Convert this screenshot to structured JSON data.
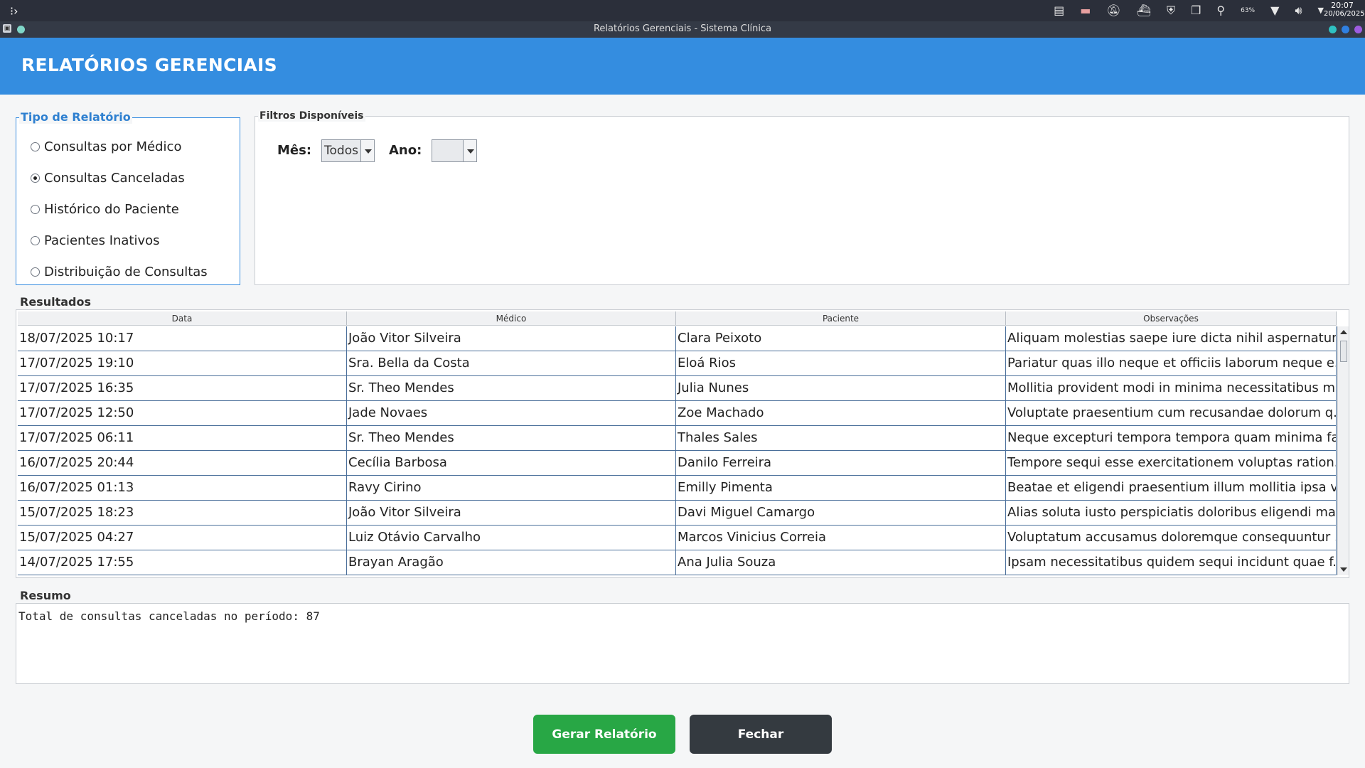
{
  "system": {
    "time": "20:07",
    "date": "20/06/2025",
    "battery": "63%"
  },
  "window": {
    "title": "Relatórios Gerenciais - Sistema Clínica"
  },
  "header": {
    "title": "RELATÓRIOS GERENCIAIS"
  },
  "report_types": {
    "legend": "Tipo de Relatório",
    "items": [
      {
        "label": "Consultas por Médico",
        "selected": false
      },
      {
        "label": "Consultas Canceladas",
        "selected": true
      },
      {
        "label": "Histórico do Paciente",
        "selected": false
      },
      {
        "label": "Pacientes Inativos",
        "selected": false
      },
      {
        "label": "Distribuição de Consultas",
        "selected": false
      }
    ]
  },
  "filters": {
    "legend": "Filtros Disponíveis",
    "month_label": "Mês:",
    "month_value": "Todos",
    "year_label": "Ano:",
    "year_value": ""
  },
  "results": {
    "legend": "Resultados",
    "columns": [
      "Data",
      "Médico",
      "Paciente",
      "Observações"
    ],
    "rows": [
      [
        "18/07/2025 10:17",
        "João Vitor Silveira",
        "Clara Peixoto",
        "Aliquam molestias saepe iure dicta nihil aspernatur ..."
      ],
      [
        "17/07/2025 19:10",
        "Sra. Bella da Costa",
        "Eloá Rios",
        "Pariatur quas illo neque et officiis laborum neque e..."
      ],
      [
        "17/07/2025 16:35",
        "Sr. Theo Mendes",
        "Julia Nunes",
        "Mollitia provident modi in minima necessitatibus m..."
      ],
      [
        "17/07/2025 12:50",
        "Jade Novaes",
        "Zoe Machado",
        "Voluptate praesentium cum recusandae dolorum q..."
      ],
      [
        "17/07/2025 06:11",
        "Sr. Theo Mendes",
        "Thales Sales",
        "Neque excepturi tempora tempora quam minima fa..."
      ],
      [
        "16/07/2025 20:44",
        "Cecília Barbosa",
        "Danilo Ferreira",
        "Tempore sequi esse exercitationem voluptas ration..."
      ],
      [
        "16/07/2025 01:13",
        "Ravy Cirino",
        "Emilly Pimenta",
        "Beatae et eligendi praesentium illum mollitia ipsa v..."
      ],
      [
        "15/07/2025 18:23",
        "João Vitor Silveira",
        "Davi Miguel Camargo",
        "Alias soluta iusto perspiciatis doloribus eligendi ma..."
      ],
      [
        "15/07/2025 04:27",
        "Luiz Otávio Carvalho",
        "Marcos Vinicius Correia",
        "Voluptatum accusamus doloremque consequuntur ..."
      ],
      [
        "14/07/2025 17:55",
        "Brayan Aragão",
        "Ana Julia Souza",
        "Ipsam necessitatibus quidem sequi incidunt quae f..."
      ]
    ]
  },
  "summary": {
    "legend": "Resumo",
    "text": "Total de consultas canceladas no período: 87"
  },
  "buttons": {
    "generate": "Gerar Relatório",
    "close": "Fechar"
  },
  "colors": {
    "header": "#348de0",
    "generate": "#28a745",
    "close": "#343a40"
  }
}
